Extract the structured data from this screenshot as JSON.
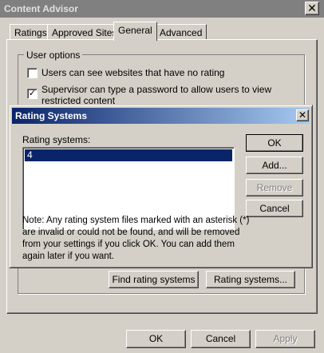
{
  "outer_window": {
    "title": "Content Advisor",
    "close_glyph": "✕",
    "tabs": [
      {
        "label": "Ratings"
      },
      {
        "label": "Approved Sites"
      },
      {
        "label": "General"
      },
      {
        "label": "Advanced"
      }
    ],
    "active_tab": "General",
    "user_options": {
      "group_label": "User options",
      "checkbox_1": {
        "label": "Users can see websites that have no rating",
        "checked": false
      },
      "checkbox_2": {
        "label_line1": "Supervisor can type a password to allow users to view",
        "label_line2": "restricted content",
        "checked": true,
        "check_glyph": "✓"
      }
    },
    "find_rating_systems_label": "Find rating systems",
    "rating_systems_label": "Rating systems...",
    "footer": {
      "ok": "OK",
      "cancel": "Cancel",
      "apply": "Apply"
    }
  },
  "dialog": {
    "title": "Rating Systems",
    "close_glyph": "✕",
    "list_label": "Rating systems:",
    "list_items": [
      "4"
    ],
    "selected_index": 0,
    "buttons": {
      "ok": "OK",
      "add": "Add...",
      "remove": "Remove",
      "cancel": "Cancel"
    },
    "note": "Note: Any rating system files marked with an asterisk (*) are invalid or could not be found, and will be removed from your settings if you click OK. You can add them again later if you want."
  },
  "colors": {
    "face": "#d4d0c8",
    "dialog_title_start": "#0a246a",
    "dialog_title_end": "#a6caf0",
    "selection": "#0a246a",
    "inactive_title": "#808080"
  }
}
